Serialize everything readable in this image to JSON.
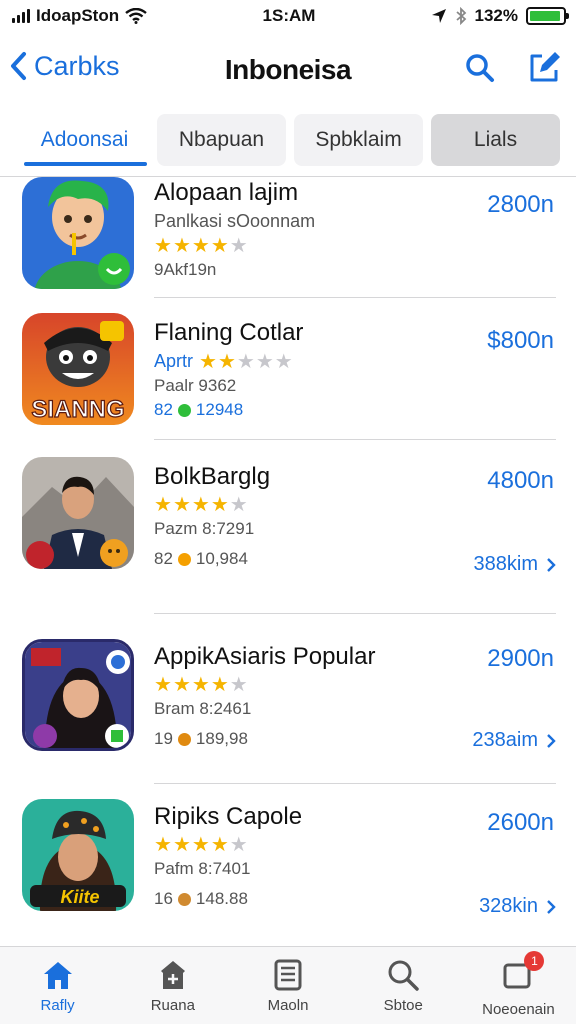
{
  "status_bar": {
    "carrier": "IdoapSton",
    "time": "1S:AM",
    "battery_text": "132%",
    "battery_level": 0.95
  },
  "nav": {
    "back_label": "Carbks",
    "title": "Inboneisa"
  },
  "tabs": [
    {
      "label": "Adoonsai"
    },
    {
      "label": "Nbapuan"
    },
    {
      "label": "Spbklaim"
    },
    {
      "label": "Lials"
    }
  ],
  "apps": [
    {
      "name": "Alopaan lajim",
      "subtitle": "Panlkasi sOoonnam",
      "rating": 3.5,
      "meta": "9Akf19n",
      "price": "2800n"
    },
    {
      "name": "Flaning Cotlar",
      "subtitle": "Aprtr",
      "rating": 2,
      "meta_top": "Paalr 9362",
      "meta_count": "82",
      "meta_value": "12948",
      "price": "$800n",
      "icon_text": "SIANNG",
      "dot_color": "#2fbe3a"
    },
    {
      "name": "BolkBarglg",
      "rating": 3.5,
      "meta_top": "Pazm 8:7291",
      "meta_count": "82",
      "meta_value": "10,984",
      "price": "4800n",
      "size": "388kim",
      "dot_color": "#f5a000"
    },
    {
      "name": "AppikAsiaris Popular",
      "rating": 3.5,
      "meta_top": "Bram 8:2461",
      "meta_count": "19",
      "meta_value": "189,98",
      "price": "2900n",
      "size": "238aim",
      "dot_color": "#e08a10"
    },
    {
      "name": "Ripiks Capole",
      "rating": 3.5,
      "meta_top": "Pafm 8:7401",
      "meta_count": "16",
      "meta_value": "148.88",
      "price": "2600n",
      "size": "328kin",
      "dot_color": "#d08a30",
      "icon_text": "Kiite"
    }
  ],
  "tab_bar": [
    {
      "label": "Rafly",
      "icon": "home-icon"
    },
    {
      "label": "Ruana",
      "icon": "games-icon"
    },
    {
      "label": "Maoln",
      "icon": "apps-icon"
    },
    {
      "label": "Sbtoe",
      "icon": "search-icon"
    },
    {
      "label": "Noeoenain",
      "icon": "updates-icon",
      "badge": "1"
    }
  ],
  "colors": {
    "accent": "#1a6fdc",
    "star": "#f5b400",
    "battery": "#2fbe3a",
    "badge": "#e53935"
  }
}
